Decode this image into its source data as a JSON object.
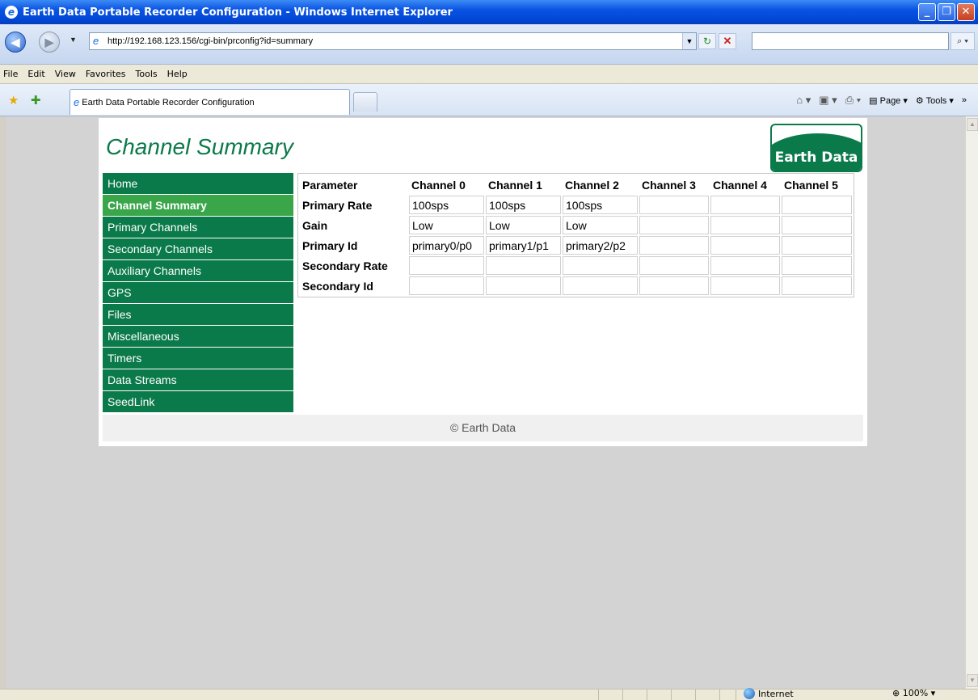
{
  "window": {
    "title": "Earth Data Portable Recorder Configuration - Windows Internet Explorer",
    "minimize": "_",
    "restore": "❐",
    "close": "✕"
  },
  "address_bar": {
    "url": "http://192.168.123.156/cgi-bin/prconfig?id=summary",
    "search_placeholder": ""
  },
  "menu": [
    "File",
    "Edit",
    "View",
    "Favorites",
    "Tools",
    "Help"
  ],
  "tab": {
    "label": "Earth Data Portable Recorder Configuration"
  },
  "command_bar": {
    "page_label": "Page",
    "tools_label": "Tools"
  },
  "page": {
    "title": "Channel Summary",
    "logo_text": "Earth Data",
    "nav": [
      {
        "label": "Home",
        "active": false
      },
      {
        "label": "Channel Summary",
        "active": true
      },
      {
        "label": "Primary Channels",
        "active": false
      },
      {
        "label": "Secondary Channels",
        "active": false
      },
      {
        "label": "Auxiliary Channels",
        "active": false
      },
      {
        "label": "GPS",
        "active": false
      },
      {
        "label": "Files",
        "active": false
      },
      {
        "label": "Miscellaneous",
        "active": false
      },
      {
        "label": "Timers",
        "active": false
      },
      {
        "label": "Data Streams",
        "active": false
      },
      {
        "label": "SeedLink",
        "active": false
      }
    ],
    "table": {
      "headers": [
        "Parameter",
        "Channel 0",
        "Channel 1",
        "Channel 2",
        "Channel 3",
        "Channel 4",
        "Channel 5"
      ],
      "rows": [
        [
          "Primary Rate",
          "100sps",
          "100sps",
          "100sps",
          "",
          "",
          ""
        ],
        [
          "Gain",
          "Low",
          "Low",
          "Low",
          "",
          "",
          ""
        ],
        [
          "Primary Id",
          "primary0/p0",
          "primary1/p1",
          "primary2/p2",
          "",
          "",
          ""
        ],
        [
          "Secondary Rate",
          "",
          "",
          "",
          "",
          "",
          ""
        ],
        [
          "Secondary Id",
          "",
          "",
          "",
          "",
          "",
          ""
        ]
      ]
    },
    "footer": "© Earth Data"
  },
  "status_bar": {
    "zone": "Internet",
    "zoom": "100%"
  },
  "colors": {
    "nav_green": "#0b7a4a",
    "nav_active": "#39a64a",
    "title_green": "#0b7a4a"
  }
}
